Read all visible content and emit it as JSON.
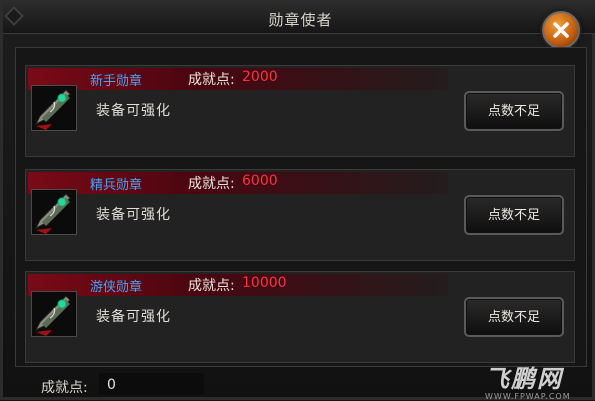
{
  "window": {
    "title": "勋章使者"
  },
  "medals": [
    {
      "name": "新手勋章",
      "points_label": "成就点:",
      "points_value": "2000",
      "description": "装备可强化",
      "button_label": "点数不足"
    },
    {
      "name": "精兵勋章",
      "points_label": "成就点:",
      "points_value": "6000",
      "description": "装备可强化",
      "button_label": "点数不足"
    },
    {
      "name": "游侠勋章",
      "points_label": "成就点:",
      "points_value": "10000",
      "description": "装备可强化",
      "button_label": "点数不足"
    }
  ],
  "footer": {
    "label": "成就点:",
    "value": "0"
  },
  "watermark": {
    "logo_text": "飞鹏网",
    "url_text": "WWW.FPWAP.COM"
  },
  "icons": {
    "close": "close-icon",
    "medal": "medal-icon"
  },
  "colors": {
    "medal_name": "#3ea5ff",
    "points_value": "#ff3040",
    "close_button": "#e07a1a"
  }
}
